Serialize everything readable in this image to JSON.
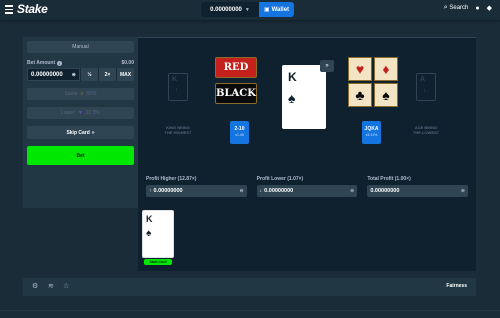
{
  "colors": {
    "background": "#1a2c38",
    "panel": "#213743",
    "game_bg": "#0f212e",
    "accent_blue": "#1475e1",
    "bet_green": "#00e701",
    "red": "#c4211d",
    "black": "#0a0a0a"
  },
  "header": {
    "logo": "Stake",
    "balance": "0.00000000",
    "wallet_label": "Wallet",
    "search_label": "Search",
    "icons": [
      "menu-icon",
      "wallet-icon",
      "search-icon",
      "user-icon",
      "notifications-icon"
    ]
  },
  "controls": {
    "mode_tab": "Manual",
    "bet_amount_label": "Bet Amount",
    "bet_amount_usd": "$0.00",
    "bet_amount_value": "0.00000000",
    "half_label": "½",
    "double_label": "2×",
    "max_label": "MAX",
    "same_label": "Same",
    "same_pct": "50%",
    "lower_label": "Lower",
    "lower_pct": "92.3%",
    "skip_label": "Skip Card",
    "bet_label": "Bet"
  },
  "game": {
    "left_ghost": {
      "rank": "K",
      "caption_1": "KING BEING",
      "caption_2": "THE HIGHEST"
    },
    "right_ghost": {
      "rank": "A",
      "caption_1": "ACE BEING",
      "caption_2": "THE LOWEST"
    },
    "red_label": "RED",
    "black_label": "BLACK",
    "current_card": {
      "rank": "K",
      "suit": "♠"
    },
    "badge_left": {
      "title": "2-10",
      "mult": "x1.45"
    },
    "badge_right": {
      "title": "JQKA",
      "mult": "x3.21%"
    },
    "suits": [
      "♥",
      "♦",
      "♣",
      "♠"
    ]
  },
  "profit": {
    "higher_label": "Profit Higher (12.87×)",
    "higher_value": "0.00000000",
    "lower_label": "Profit Lower (1.07×)",
    "lower_value": "0.00000000",
    "total_label": "Total Profit (1.00×)",
    "total_value": "0.00000000"
  },
  "history": {
    "card_rank": "K",
    "card_suit": "♠",
    "start_label": "Start Card"
  },
  "footer": {
    "fairness_label": "Fairness",
    "icons": [
      "settings-icon",
      "stats-icon",
      "favorite-icon"
    ]
  }
}
